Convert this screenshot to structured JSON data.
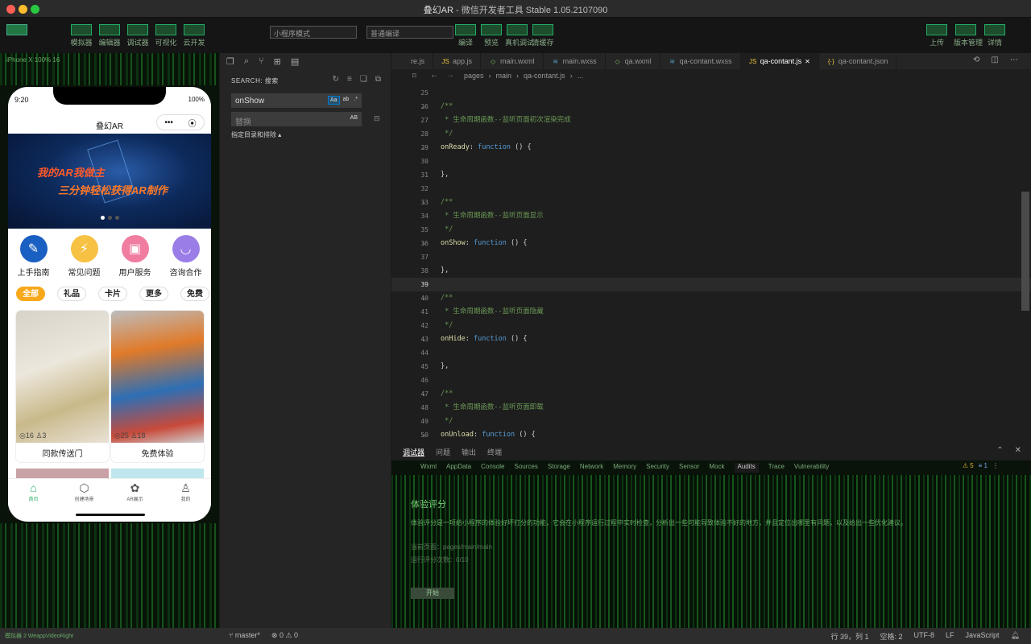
{
  "window": {
    "title": "叠幻AR",
    "subtitle": " - 微信开发者工具 Stable 1.05.2107090",
    "traffic_colors": [
      "#ff5f57",
      "#febc2e",
      "#28c840"
    ]
  },
  "toolbar": {
    "left_buttons": [
      "模拟器",
      "编辑器",
      "调试器",
      "可视化",
      "云开发"
    ],
    "mode_select": "小程序模式",
    "compile_select": "普通编译",
    "mid_buttons": [
      "编译",
      "预览",
      "真机调试",
      "清缓存"
    ],
    "right_buttons": [
      "上传",
      "版本管理",
      "详情"
    ]
  },
  "simulator": {
    "device_info": "iPhone X 100% 16",
    "status_time": "9:20",
    "status_battery": "100%",
    "nav_title": "叠幻AR",
    "capsule_more": "•••",
    "capsule_close": "⦿",
    "banner": {
      "line1": "我的AR我做主",
      "line2": "三分钟轻松获得AR制作"
    },
    "quick": [
      {
        "label": "上手指南",
        "icon": "compass-icon",
        "glyph": "✎",
        "color": "#1a5fc2"
      },
      {
        "label": "常见问题",
        "icon": "lightning-icon",
        "glyph": "⚡",
        "color": "#f7c144"
      },
      {
        "label": "用户服务",
        "icon": "image-icon",
        "glyph": "▣",
        "color": "#f07ca0"
      },
      {
        "label": "咨询合作",
        "icon": "chat-icon",
        "glyph": "◡",
        "color": "#9b7de8"
      }
    ],
    "categories": [
      "全部",
      "礼品",
      "卡片",
      "更多",
      "免费"
    ],
    "active_category": 0,
    "cards": [
      {
        "title": "同款传送门",
        "meta": "◎16 ♙3"
      },
      {
        "title": "免费体验",
        "meta": "◎25 ♙18"
      }
    ],
    "tabs": [
      {
        "label": "首页",
        "glyph": "⌂",
        "icon": "home-icon"
      },
      {
        "label": "创建场景",
        "glyph": "⬡",
        "icon": "cube-icon"
      },
      {
        "label": "AR展示",
        "glyph": "✿",
        "icon": "lotus-icon"
      },
      {
        "label": "我的",
        "glyph": "♙",
        "icon": "user-icon"
      }
    ],
    "active_tab": 0
  },
  "search": {
    "header": "SEARCH: 搜索",
    "query": "onShow",
    "replace_placeholder": "替换",
    "opt_case": "Aa",
    "opt_word": "ab",
    "opt_regex": ".*",
    "opt_preserve": "AB",
    "include_toggle": "指定目录和排除 ▴"
  },
  "editor": {
    "tabs": [
      {
        "label": "re.js",
        "icon": "js-icon",
        "glyph": "",
        "color": "#e8c33a"
      },
      {
        "label": "app.js",
        "icon": "js-icon",
        "glyph": "JS",
        "color": "#e8c33a"
      },
      {
        "label": "main.wxml",
        "icon": "wxml-icon",
        "glyph": "◇",
        "color": "#7fbf5f"
      },
      {
        "label": "main.wxss",
        "icon": "wxss-icon",
        "glyph": "≋",
        "color": "#519aba"
      },
      {
        "label": "qa.wxml",
        "icon": "wxml-icon",
        "glyph": "◇",
        "color": "#7fbf5f"
      },
      {
        "label": "qa-contant.wxss",
        "icon": "wxss-icon",
        "glyph": "≋",
        "color": "#519aba"
      },
      {
        "label": "qa-contant.js",
        "icon": "js-icon",
        "glyph": "JS",
        "color": "#e8c33a"
      },
      {
        "label": "qa-contant.json",
        "icon": "json-icon",
        "glyph": "{·}",
        "color": "#e8c33a"
      }
    ],
    "active_tab": 6,
    "breadcrumb": [
      "pages",
      "main",
      "qa-contant.js",
      "..."
    ],
    "current_line": "39",
    "lines": [
      {
        "n": "25",
        "fold": "",
        "parts": []
      },
      {
        "n": "26",
        "fold": "⌄",
        "parts": [
          {
            "t": "/**",
            "c": "cm"
          }
        ]
      },
      {
        "n": "27",
        "fold": "",
        "parts": [
          {
            "t": " * 生命周期函数--监听页面初次渲染完成",
            "c": "cm"
          }
        ]
      },
      {
        "n": "28",
        "fold": "",
        "parts": [
          {
            "t": " */",
            "c": "cm"
          }
        ]
      },
      {
        "n": "29",
        "fold": "⌄",
        "parts": [
          {
            "t": "onReady",
            "c": "kw"
          },
          {
            "t": ": ",
            "c": "pl"
          },
          {
            "t": "function",
            "c": "fn"
          },
          {
            "t": " () {",
            "c": "pl"
          }
        ]
      },
      {
        "n": "30",
        "fold": "",
        "parts": []
      },
      {
        "n": "31",
        "fold": "",
        "parts": [
          {
            "t": "},",
            "c": "pl"
          }
        ]
      },
      {
        "n": "32",
        "fold": "",
        "parts": []
      },
      {
        "n": "33",
        "fold": "⌄",
        "parts": [
          {
            "t": "/**",
            "c": "cm"
          }
        ]
      },
      {
        "n": "34",
        "fold": "",
        "parts": [
          {
            "t": " * 生命周期函数--监听页面显示",
            "c": "cm"
          }
        ]
      },
      {
        "n": "35",
        "fold": "",
        "parts": [
          {
            "t": " */",
            "c": "cm"
          }
        ]
      },
      {
        "n": "36",
        "fold": "⌄",
        "parts": [
          {
            "t": "onShow",
            "c": "kw"
          },
          {
            "t": ": ",
            "c": "pl"
          },
          {
            "t": "function",
            "c": "fn"
          },
          {
            "t": " () {",
            "c": "pl"
          }
        ]
      },
      {
        "n": "37",
        "fold": "",
        "parts": []
      },
      {
        "n": "38",
        "fold": "",
        "parts": [
          {
            "t": "},",
            "c": "pl"
          }
        ]
      },
      {
        "n": "39",
        "fold": "",
        "parts": []
      },
      {
        "n": "40",
        "fold": "⌄",
        "parts": [
          {
            "t": "/**",
            "c": "cm"
          }
        ]
      },
      {
        "n": "41",
        "fold": "",
        "parts": [
          {
            "t": " * 生命周期函数--监听页面隐藏",
            "c": "cm"
          }
        ]
      },
      {
        "n": "42",
        "fold": "",
        "parts": [
          {
            "t": " */",
            "c": "cm"
          }
        ]
      },
      {
        "n": "43",
        "fold": "⌄",
        "parts": [
          {
            "t": "onHide",
            "c": "kw"
          },
          {
            "t": ": ",
            "c": "pl"
          },
          {
            "t": "function",
            "c": "fn"
          },
          {
            "t": " () {",
            "c": "pl"
          }
        ]
      },
      {
        "n": "44",
        "fold": "",
        "parts": []
      },
      {
        "n": "45",
        "fold": "",
        "parts": [
          {
            "t": "},",
            "c": "pl"
          }
        ]
      },
      {
        "n": "46",
        "fold": "",
        "parts": []
      },
      {
        "n": "47",
        "fold": "⌄",
        "parts": [
          {
            "t": "/**",
            "c": "cm"
          }
        ]
      },
      {
        "n": "48",
        "fold": "",
        "parts": [
          {
            "t": " * 生命周期函数--监听页面卸载",
            "c": "cm"
          }
        ]
      },
      {
        "n": "49",
        "fold": "",
        "parts": [
          {
            "t": " */",
            "c": "cm"
          }
        ]
      },
      {
        "n": "50",
        "fold": "⌄",
        "parts": [
          {
            "t": "onUnload",
            "c": "kw"
          },
          {
            "t": ": ",
            "c": "pl"
          },
          {
            "t": "function",
            "c": "fn"
          },
          {
            "t": " () {",
            "c": "pl"
          }
        ]
      }
    ]
  },
  "panel": {
    "tabs": [
      "调试器",
      "问题",
      "输出",
      "终端"
    ],
    "active_tab": 0,
    "devtool_tabs": [
      "Wxml",
      "AppData",
      "Console",
      "Sources",
      "Storage",
      "Network",
      "Memory",
      "Security",
      "Sensor",
      "Mock",
      "Audits",
      "Trace",
      "Vulnerability"
    ],
    "active_devtool_tab": 10,
    "warn_badge": "⚠ 5",
    "info_badge": "≡ 1",
    "audits_title": "体验评分",
    "audits_desc": "体验评分是一项给小程序的体验好坏打分的功能，它会在小程序运行过程中实时检查，分析出一些可能导致体验不好的地方，并且定位出哪里有问题，以及给出一些优化建议。",
    "audits_page": "当前页面：pages/main/main",
    "audits_count": "运行评分次数：0/10",
    "audits_button": "开始"
  },
  "status": {
    "left_glitch": "模拟器 2   WeappVideoRight",
    "branch": "master*",
    "problems": "⊗ 0 ⚠ 0",
    "position": "行 39，列 1",
    "spaces": "空格: 2",
    "encoding": "UTF-8",
    "eol": "LF",
    "language": "JavaScript"
  }
}
